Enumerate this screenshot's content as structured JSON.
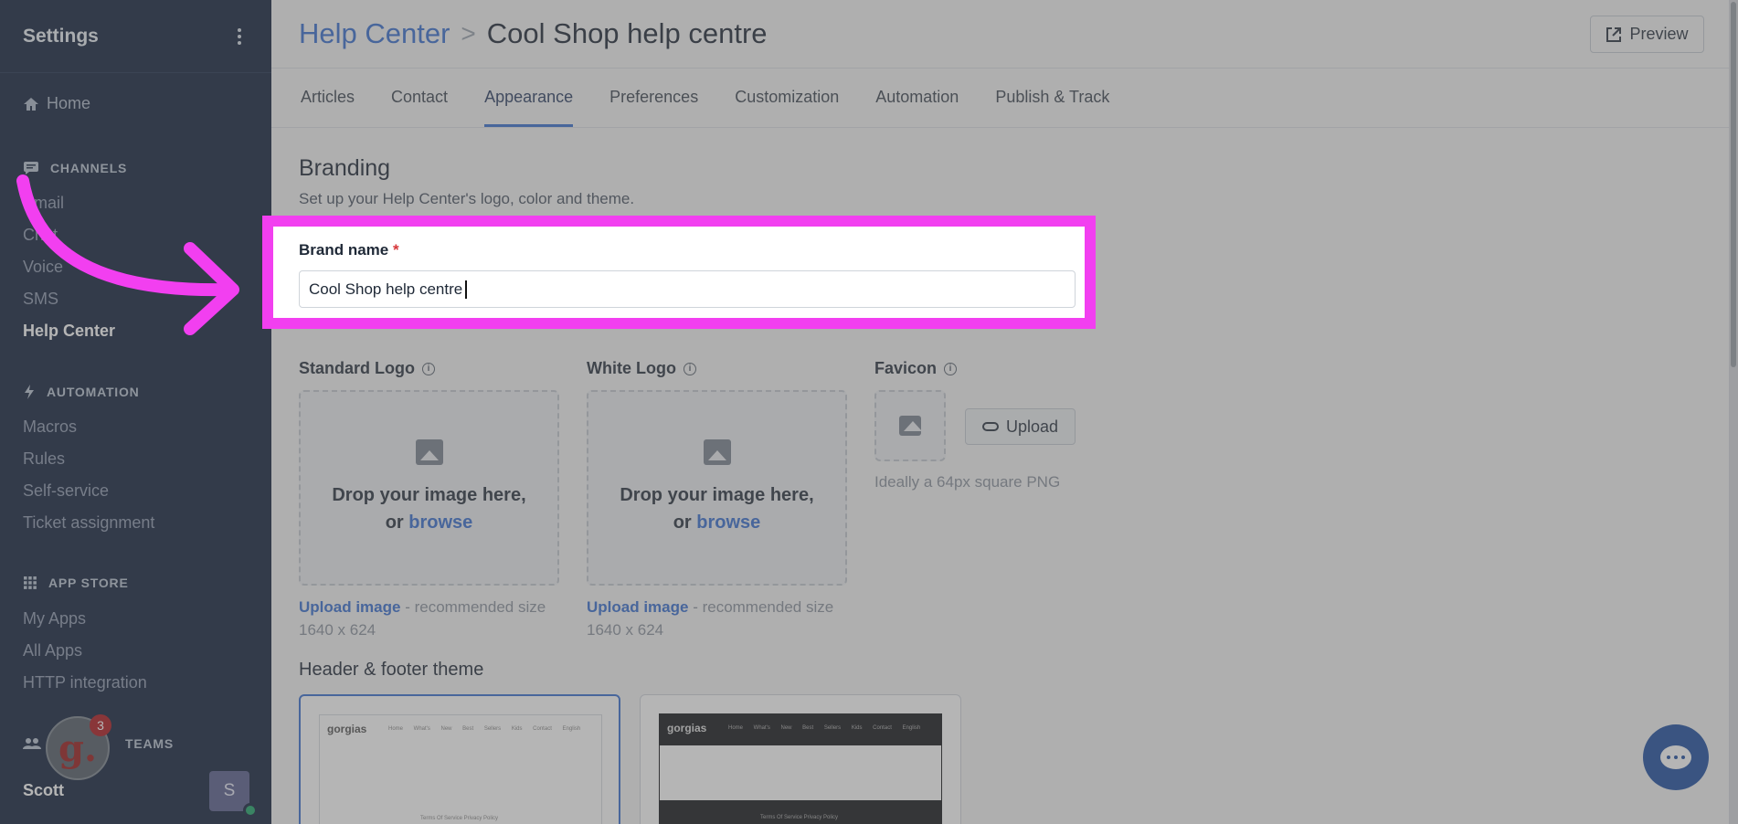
{
  "sidebar": {
    "title": "Settings",
    "home": "Home",
    "sections": {
      "channels": "CHANNELS",
      "automation": "AUTOMATION",
      "app_store": "APP STORE",
      "teams": "TEAMS"
    },
    "channel_items": [
      "Email",
      "Chat",
      "Voice",
      "SMS",
      "Help Center"
    ],
    "automation_items": [
      "Macros",
      "Rules",
      "Self-service",
      "Ticket assignment"
    ],
    "app_items": [
      "My Apps",
      "All Apps",
      "HTTP integration"
    ],
    "user_name": "Scott",
    "avatar_letter": "S",
    "notification_count": "3",
    "gorgias_letter": "g."
  },
  "header": {
    "crumb_parent": "Help Center",
    "crumb_sep": ">",
    "crumb_current": "Cool Shop help centre",
    "preview_label": "Preview"
  },
  "tabs": [
    "Articles",
    "Contact",
    "Appearance",
    "Preferences",
    "Customization",
    "Automation",
    "Publish & Track"
  ],
  "active_tab": "Appearance",
  "branding": {
    "title": "Branding",
    "subtitle": "Set up your Help Center's logo, color and theme.",
    "brand_label": "Brand name",
    "required_mark": "*",
    "brand_value": "Cool Shop help centre"
  },
  "logos": {
    "standard_label": "Standard Logo",
    "white_label": "White Logo",
    "favicon_label": "Favicon",
    "drop_line1": "Drop your image here,",
    "drop_or": "or",
    "browse": "browse",
    "upload_link": "Upload image",
    "upload_rest": " - recommended size 1640 x 624",
    "favicon_upload": "Upload",
    "favicon_hint": "Ideally a 64px square PNG"
  },
  "theme": {
    "title": "Header & footer theme",
    "brand": "gorgias",
    "nav_links": "Home What's New Best Sellers Kids Contact English",
    "footer_links": "Terms Of Service Privacy Policy"
  },
  "colors": {
    "accent": "#3a6fd0",
    "highlight": "#f23ff0",
    "sidebar_bg": "#13223d"
  }
}
